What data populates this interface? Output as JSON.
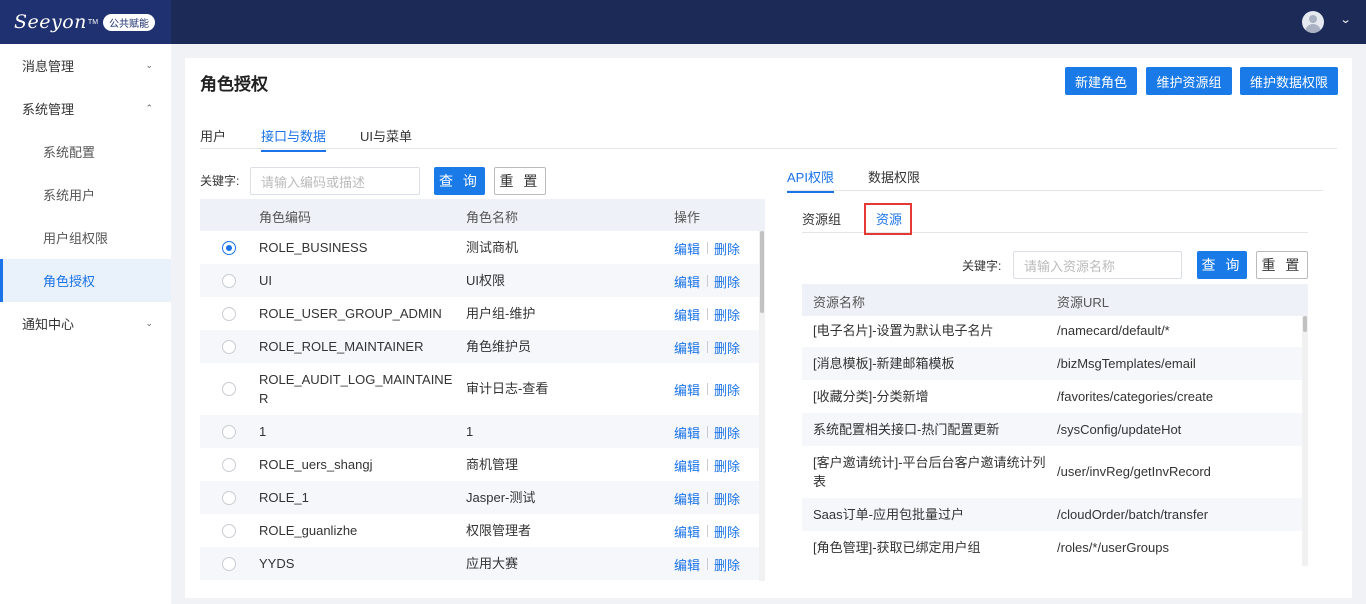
{
  "brand": {
    "logo_text": "Seeyon",
    "tm": "TM",
    "badge": "公共赋能"
  },
  "header": {
    "user_menu_chevron": "⌄"
  },
  "sidebar": {
    "menus": [
      {
        "label": "消息管理",
        "chevron": "⌄"
      },
      {
        "label": "系统管理",
        "chevron": "⌃"
      }
    ],
    "sub_items": [
      {
        "label": "系统配置"
      },
      {
        "label": "系统用户"
      },
      {
        "label": "用户组权限"
      },
      {
        "label": "角色授权",
        "active": true
      }
    ],
    "after": {
      "label": "通知中心",
      "chevron": "⌄"
    }
  },
  "page": {
    "title": "角色授权",
    "buttons": {
      "new_role": "新建角色",
      "maintain_resource_group": "维护资源组",
      "maintain_data_permission": "维护数据权限"
    },
    "tabs": [
      "用户",
      "接口与数据",
      "UI与菜单"
    ],
    "active_tab": "接口与数据"
  },
  "left": {
    "keyword_label": "关键字:",
    "search_placeholder": "请输入编码或描述",
    "query_label": "查 询",
    "reset_label": "重 置",
    "columns": {
      "code": "角色编码",
      "name": "角色名称",
      "op": "操作"
    },
    "edit_label": "编辑",
    "delete_label": "删除",
    "rows": [
      {
        "code": "ROLE_BUSINESS",
        "name": "测试商机",
        "selected": true
      },
      {
        "code": "UI",
        "name": "UI权限"
      },
      {
        "code": "ROLE_USER_GROUP_ADMIN",
        "name": "用户组-维护"
      },
      {
        "code": "ROLE_ROLE_MAINTAINER",
        "name": "角色维护员"
      },
      {
        "code_line1": "ROLE_AUDIT_LOG_MAINTAINE",
        "code_line2": "R",
        "name": "审计日志-查看"
      },
      {
        "code": "1",
        "name": "1"
      },
      {
        "code": "ROLE_uers_shangj",
        "name": "商机管理"
      },
      {
        "code": "ROLE_1",
        "name": "Jasper-测试"
      },
      {
        "code": "ROLE_guanlizhe",
        "name": "权限管理者"
      },
      {
        "code": "YYDS",
        "name": "应用大赛"
      }
    ]
  },
  "right": {
    "tabs": [
      "API权限",
      "数据权限"
    ],
    "active_tab": "API权限",
    "subtabs": [
      "资源组",
      "资源"
    ],
    "active_subtab": "资源",
    "keyword_label": "关键字:",
    "search_placeholder": "请输入资源名称",
    "query_label": "查 询",
    "reset_label": "重 置",
    "columns": {
      "name": "资源名称",
      "url": "资源URL"
    },
    "rows": [
      {
        "name": "[电子名片]-设置为默认电子名片",
        "url": "/namecard/default/*"
      },
      {
        "name": "[消息模板]-新建邮箱模板",
        "url": "/bizMsgTemplates/email"
      },
      {
        "name": "[收藏分类]-分类新增",
        "url": "/favorites/categories/create"
      },
      {
        "name": "系统配置相关接口-热门配置更新",
        "url": "/sysConfig/updateHot"
      },
      {
        "name_line1": "[客户邀请统计]-平台后台客户邀请统计列",
        "name_line2": "表",
        "url": "/user/invReg/getInvRecord"
      },
      {
        "name": "Saas订单-应用包批量过户",
        "url": "/cloudOrder/batch/transfer"
      },
      {
        "name": "[角色管理]-获取已绑定用户组",
        "url": "/roles/*/userGroups"
      }
    ]
  },
  "colors": {
    "primary": "#1a7ae8",
    "header_bg": "#1b2a57",
    "highlight": "#e53935"
  }
}
